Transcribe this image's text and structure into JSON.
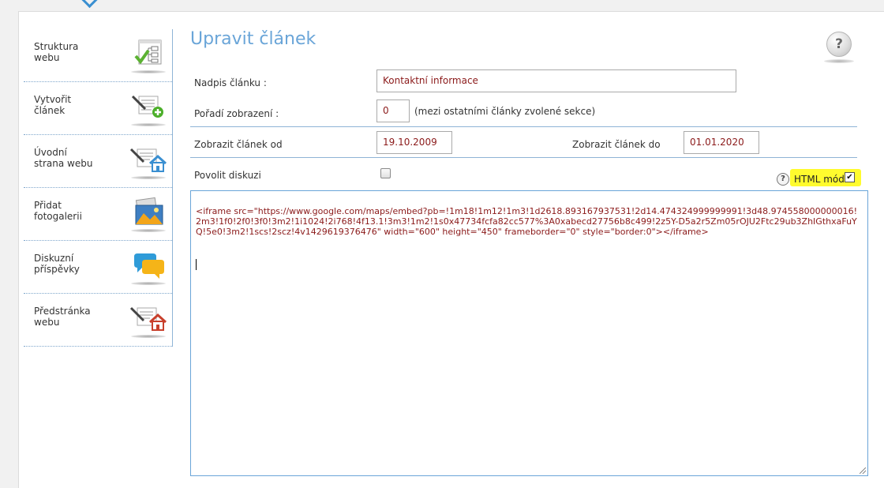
{
  "sidebar": {
    "items": [
      {
        "line1": "Struktura",
        "line2": "webu",
        "icon": "site-structure-icon"
      },
      {
        "line1": "Vytvořit",
        "line2": "článek",
        "icon": "create-article-icon"
      },
      {
        "line1": "Úvodní",
        "line2": "strana webu",
        "icon": "homepage-icon"
      },
      {
        "line1": "Přidat",
        "line2": "fotogalerii",
        "icon": "photo-gallery-icon"
      },
      {
        "line1": "Diskuzní",
        "line2": "příspěvky",
        "icon": "discussion-icon"
      },
      {
        "line1": "Předstránka",
        "line2": "webu",
        "icon": "intro-page-icon"
      }
    ]
  },
  "main": {
    "title": "Upravit článek",
    "help_symbol": "?",
    "form": {
      "headline_label": "Nadpis článku :",
      "headline_value": "Kontaktní informace",
      "order_label": "Pořadí zobrazení :",
      "order_value": "0",
      "order_hint": "(mezi ostatními články zvolené sekce)",
      "show_from_label": "Zobrazit článek od",
      "show_from_value": "19.10.2009",
      "show_to_label": "Zobrazit článek do",
      "show_to_value": "01.01.2020",
      "discussion_label": "Povolit diskuzi",
      "discussion_checked": false,
      "html_mode_label": "HTML mód",
      "html_mode_checked": true,
      "help_small_symbol": "?"
    },
    "editor": {
      "content": "<iframe src=\"https://www.google.com/maps/embed?pb=!1m18!1m12!1m3!1d2618.893167937531!2d14.474324999999991!3d48.974558000000016!2m3!1f0!2f0!3f0!3m2!1i1024!2i768!4f13.1!3m3!1m2!1s0x47734fcfa82cc577%3A0xabecd27756b8c499!2z5Y-D5a2r5Zm05rOJU2Ftc29ub3ZhIGthxaFuYQ!5e0!3m2!1scs!2scz!4v1429619376476\" width=\"600\" height=\"450\" frameborder=\"0\" style=\"border:0\"></iframe>"
    }
  },
  "colors": {
    "accent": "#6aa5d8",
    "value_text": "#8b1a1a",
    "highlight": "#fffb2e"
  }
}
